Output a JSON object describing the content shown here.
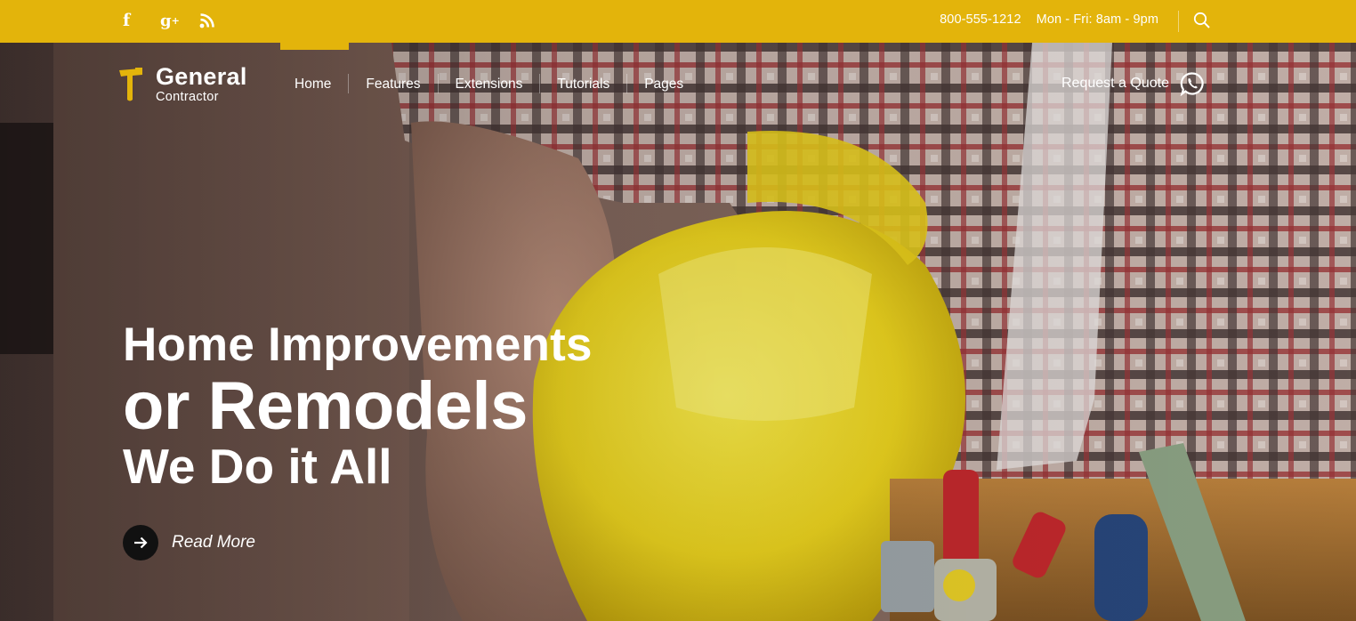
{
  "topbar": {
    "social": [
      {
        "icon": "facebook-icon",
        "glyph": "f"
      },
      {
        "icon": "google-plus-icon",
        "glyph": "g",
        "sup": "+"
      },
      {
        "icon": "rss-icon"
      }
    ],
    "phone": "800-555-1212",
    "hours": "Mon - Fri: 8am - 9pm",
    "search_icon": "search-icon"
  },
  "brand": {
    "name": "General",
    "tagline": "Contractor",
    "icon": "hammer-icon"
  },
  "nav": {
    "items": [
      {
        "label": "Home",
        "active": true
      },
      {
        "label": "Features"
      },
      {
        "label": "Extensions"
      },
      {
        "label": "Tutorials"
      },
      {
        "label": "Pages"
      }
    ]
  },
  "header_cta": {
    "label": "Request a Quote",
    "icon": "whatsapp-icon"
  },
  "hero": {
    "line1": "Home Improvements",
    "line2": "or Remodels",
    "line3": "We Do it All",
    "read_more": "Read More",
    "read_more_icon": "arrow-right-icon"
  },
  "colors": {
    "accent": "#e3b40b",
    "text": "#ffffff",
    "button_dark": "#111111"
  }
}
